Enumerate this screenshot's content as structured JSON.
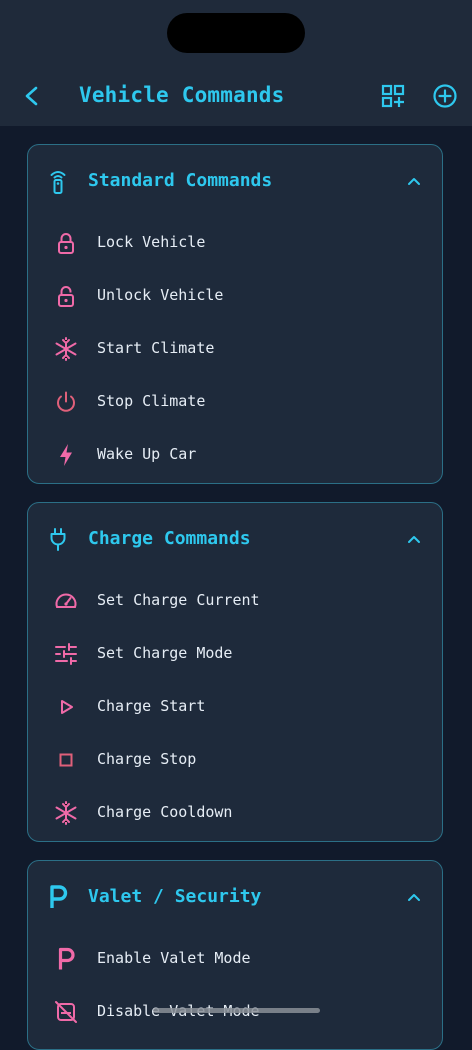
{
  "header": {
    "title": "Vehicle Commands"
  },
  "icons": {
    "back": "chevron-left-icon",
    "grid_add": "grid-add-icon",
    "add": "plus-circle-icon"
  },
  "colors": {
    "accent": "#2ec8ee",
    "item_icon": "#f06aa8",
    "border": "#2b6f86"
  },
  "sections": [
    {
      "title": "Standard Commands",
      "icon": "remote-icon",
      "items": [
        {
          "label": "Lock Vehicle",
          "icon": "lock-icon"
        },
        {
          "label": "Unlock Vehicle",
          "icon": "unlock-icon"
        },
        {
          "label": "Start Climate",
          "icon": "snowflake-icon"
        },
        {
          "label": "Stop Climate",
          "icon": "power-icon"
        },
        {
          "label": "Wake Up Car",
          "icon": "bolt-icon"
        }
      ]
    },
    {
      "title": "Charge Commands",
      "icon": "plug-icon",
      "items": [
        {
          "label": "Set Charge Current",
          "icon": "gauge-icon"
        },
        {
          "label": "Set Charge Mode",
          "icon": "sliders-icon"
        },
        {
          "label": "Charge Start",
          "icon": "play-icon"
        },
        {
          "label": "Charge Stop",
          "icon": "stop-icon"
        },
        {
          "label": "Charge Cooldown",
          "icon": "snowflake-icon"
        }
      ]
    },
    {
      "title": "Valet / Security",
      "icon": "parking-icon",
      "items": [
        {
          "label": "Enable Valet Mode",
          "icon": "parking-icon"
        },
        {
          "label": "Disable Valet Mode",
          "icon": "no-car-icon"
        }
      ]
    }
  ]
}
